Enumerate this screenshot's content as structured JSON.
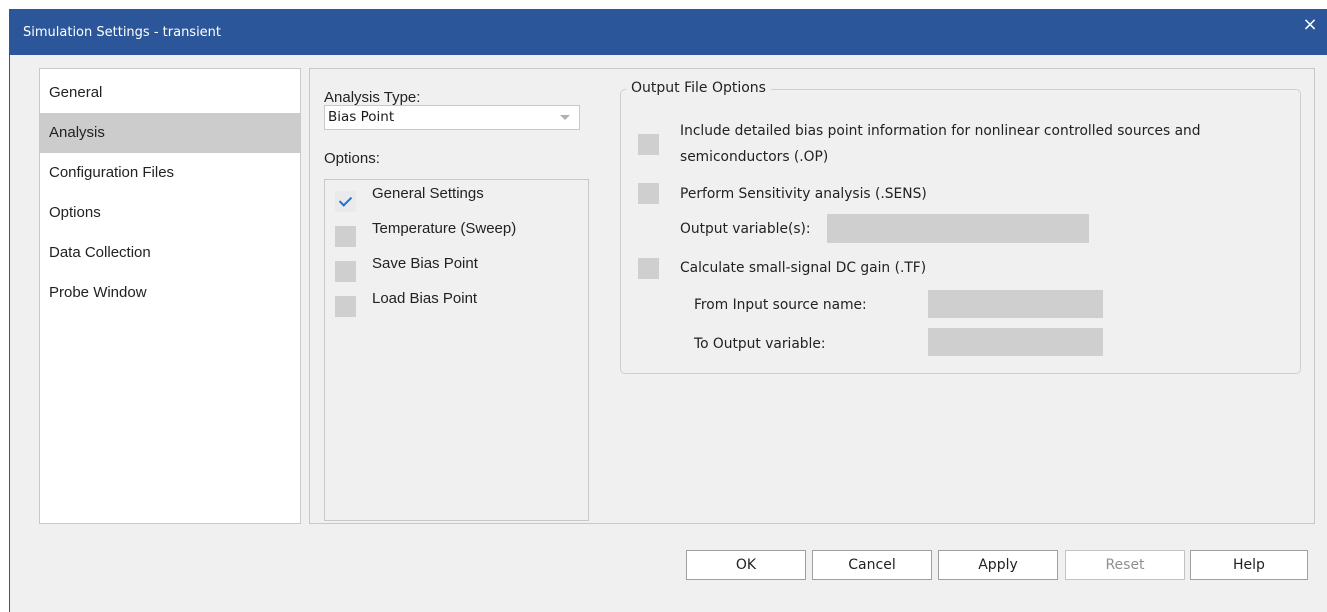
{
  "window": {
    "title": "Simulation Settings - transient",
    "close_glyph": "×"
  },
  "nav": {
    "items": [
      {
        "label": "General",
        "selected": false
      },
      {
        "label": "Analysis",
        "selected": true
      },
      {
        "label": "Configuration Files",
        "selected": false
      },
      {
        "label": "Options",
        "selected": false
      },
      {
        "label": "Data Collection",
        "selected": false
      },
      {
        "label": "Probe Window",
        "selected": false
      }
    ]
  },
  "analysis": {
    "type_label": "Analysis Type:",
    "type_value": "Bias Point",
    "options_label": "Options:",
    "options": [
      {
        "label": "General Settings",
        "checked": true
      },
      {
        "label": "Temperature (Sweep)",
        "checked": false
      },
      {
        "label": "Save Bias Point",
        "checked": false
      },
      {
        "label": "Load Bias Point",
        "checked": false
      }
    ]
  },
  "output": {
    "title": "Output File Options",
    "op_line1": "Include detailed bias point information for nonlinear controlled sources and",
    "op_line2": "semiconductors (.OP)",
    "op_checked": false,
    "sens_label": "Perform Sensitivity analysis (.SENS)",
    "sens_checked": false,
    "output_vars_label": "Output variable(s):",
    "output_vars_value": "",
    "tf_label": "Calculate small-signal DC gain (.TF)",
    "tf_checked": false,
    "from_label": "From Input source name:",
    "from_value": "",
    "to_label": "To Output variable:",
    "to_value": ""
  },
  "buttons": {
    "ok": "OK",
    "cancel": "Cancel",
    "apply": "Apply",
    "reset": "Reset",
    "help": "Help"
  },
  "colors": {
    "titlebar": "#2b579a",
    "check": "#1e73d8",
    "selected_nav": "#cccccc"
  }
}
